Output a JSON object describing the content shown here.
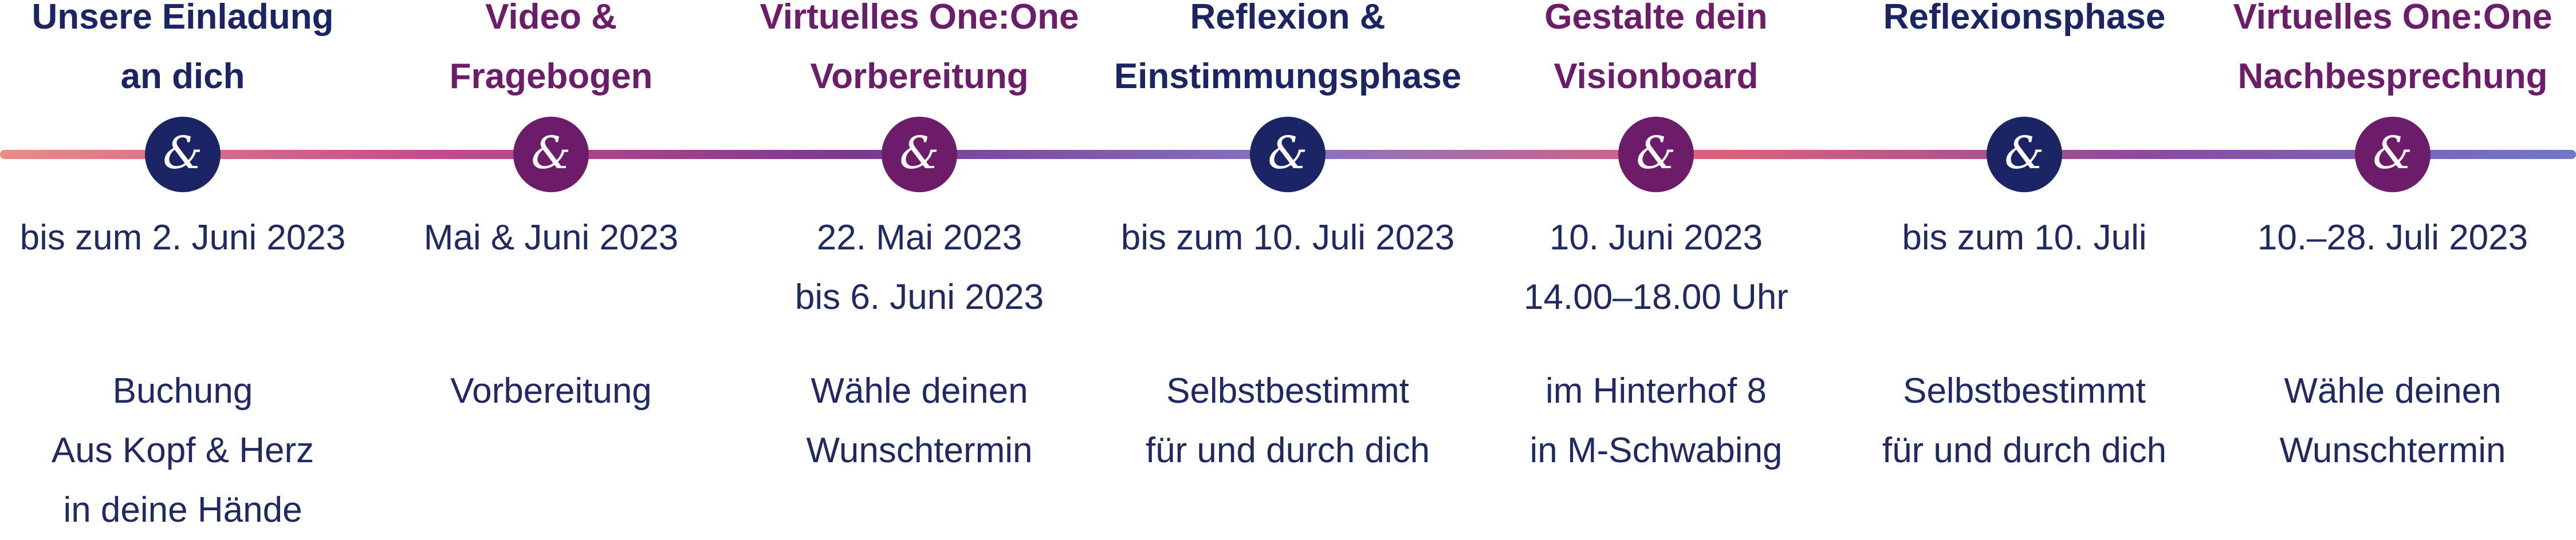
{
  "colors": {
    "navy": "#1b2566",
    "plum": "#6d1c6a",
    "text": "#1f2a63",
    "line_gradient": [
      "#e98b86",
      "#c94a8c",
      "#7a3a8e",
      "#8673c4",
      "#e0607a",
      "#8c4a9e",
      "#6f78c8"
    ]
  },
  "node_icon": "ampersand-icon",
  "node_glyph": "&",
  "steps": [
    {
      "title": "Unsere Einladung\nan dich",
      "title_color": "#1b2566",
      "node_color": "#1b2566",
      "date": "bis zum 2. Juni 2023",
      "description": "Buchung\nAus Kopf & Herz\nin deine Hände"
    },
    {
      "title": "Video &\nFragebogen",
      "title_color": "#6d1c6a",
      "node_color": "#6d1c6a",
      "date": "Mai & Juni 2023",
      "description": "Vorbereitung"
    },
    {
      "title": "Virtuelles One:One\nVorbereitung",
      "title_color": "#6d1c6a",
      "node_color": "#6d1c6a",
      "date": "22. Mai 2023\nbis 6. Juni 2023",
      "description": "Wähle deinen\nWunschtermin"
    },
    {
      "title": "Reflexion &\nEinstimmungsphase",
      "title_color": "#1b2566",
      "node_color": "#1b2566",
      "date": "bis zum 10. Juli 2023",
      "description": "Selbstbestimmt\nfür und durch dich"
    },
    {
      "title": "Gestalte dein\nVisionboard",
      "title_color": "#6d1c6a",
      "node_color": "#6d1c6a",
      "date": "10. Juni 2023\n14.00–18.00 Uhr",
      "description": "im Hinterhof 8\nin M-Schwabing"
    },
    {
      "title": "Reflexionsphase",
      "title_color": "#1b2566",
      "node_color": "#1b2566",
      "date": "bis zum 10. Juli",
      "description": "Selbstbestimmt\nfür und durch dich"
    },
    {
      "title": "Virtuelles One:One\nNachbesprechung",
      "title_color": "#6d1c6a",
      "node_color": "#6d1c6a",
      "date": "10.–28. Juli 2023",
      "description": "Wähle deinen\nWunschtermin"
    }
  ]
}
